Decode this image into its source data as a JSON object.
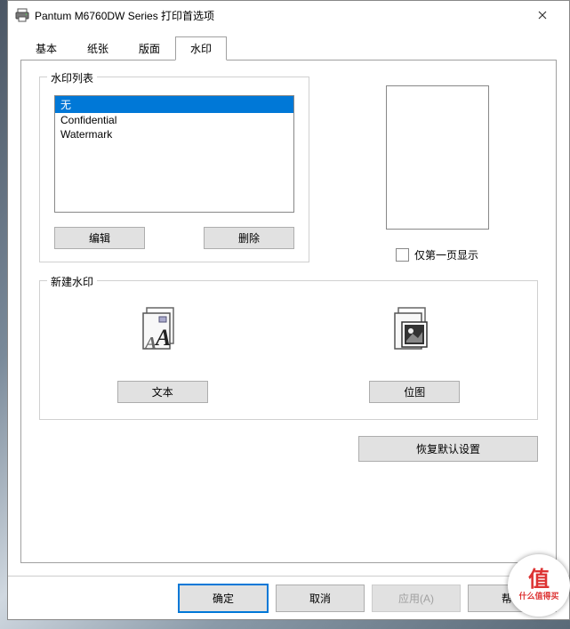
{
  "title": "Pantum M6760DW Series 打印首选项",
  "tabs": [
    "基本",
    "纸张",
    "版面",
    "水印"
  ],
  "activeTab": 3,
  "watermarkList": {
    "title": "水印列表",
    "items": [
      "无",
      "Confidential",
      "Watermark"
    ],
    "selectedIndex": 0,
    "editBtn": "编辑",
    "deleteBtn": "删除"
  },
  "firstPageOnly": {
    "checked": false,
    "label": "仅第一页显示"
  },
  "newWatermark": {
    "title": "新建水印",
    "textBtn": "文本",
    "bitmapBtn": "位图"
  },
  "restoreBtn": "恢复默认设置",
  "footer": {
    "ok": "确定",
    "cancel": "取消",
    "apply": "应用(A)",
    "help": "帮助"
  },
  "badge": {
    "brand": "值",
    "tag": "什么值得买"
  }
}
